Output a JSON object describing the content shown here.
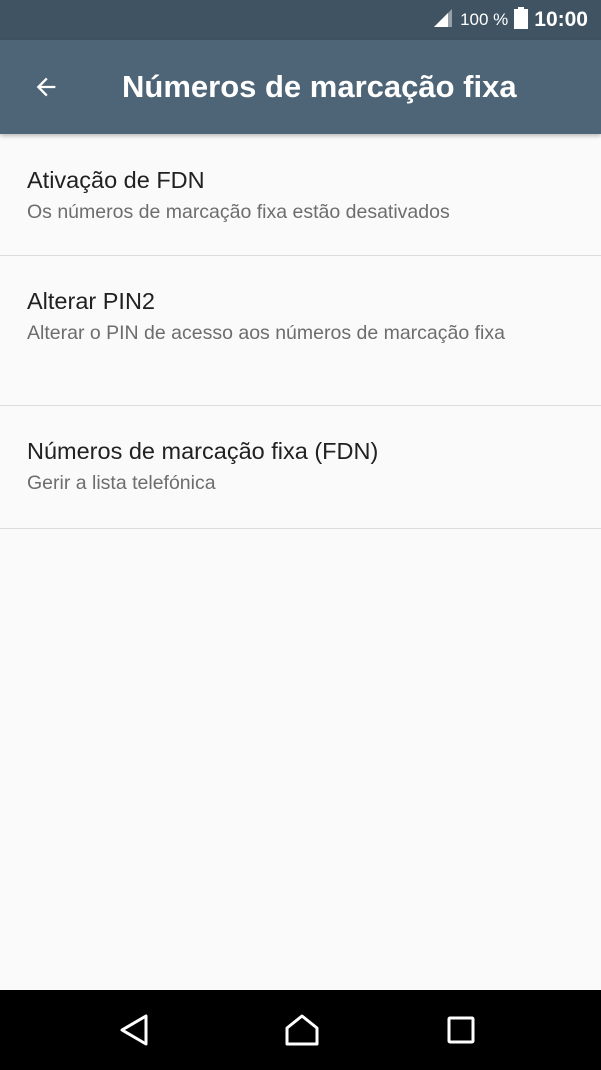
{
  "status_bar": {
    "battery_percent": "100 %",
    "time": "10:00",
    "icons": [
      "signal-icon",
      "battery-icon"
    ]
  },
  "app_bar": {
    "title": "Números de marcação fixa",
    "back_icon": "arrow-left-icon"
  },
  "settings": [
    {
      "title": "Ativação de FDN",
      "summary": "Os números de marcação fixa estão desativados"
    },
    {
      "title": "Alterar PIN2",
      "summary": "Alterar o PIN de acesso aos números de marcação fixa"
    },
    {
      "title": "Números de marcação fixa (FDN)",
      "summary": "Gerir a lista telefónica"
    }
  ],
  "nav_bar": {
    "icons": [
      "nav-back-icon",
      "nav-home-icon",
      "nav-recents-icon"
    ]
  },
  "colors": {
    "status_bar": "#3f5363",
    "app_bar": "#4e6477",
    "background": "#fafafa",
    "divider": "#dcdcdc",
    "title_text": "#212121",
    "summary_text": "#6d6d6d",
    "nav_bar": "#000000"
  }
}
